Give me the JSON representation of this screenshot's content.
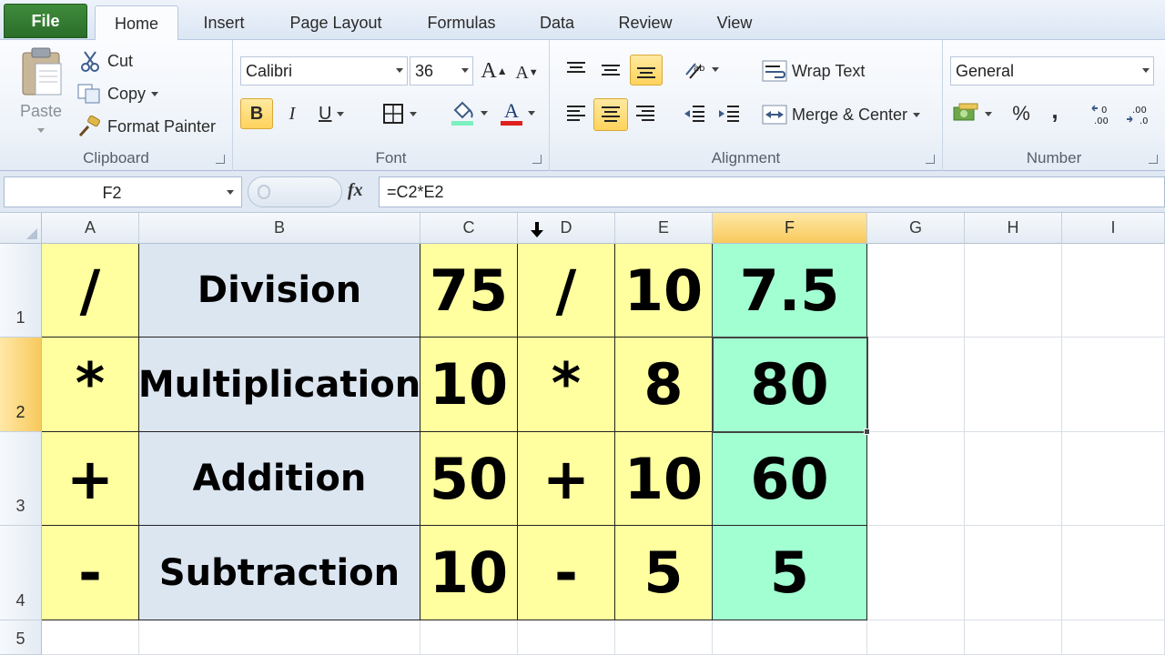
{
  "tabs": {
    "file": "File",
    "home": "Home",
    "insert": "Insert",
    "page_layout": "Page Layout",
    "formulas": "Formulas",
    "data": "Data",
    "review": "Review",
    "view": "View"
  },
  "ribbon": {
    "clipboard": {
      "label": "Clipboard",
      "paste": "Paste",
      "cut": "Cut",
      "copy": "Copy",
      "format_painter": "Format Painter"
    },
    "font": {
      "label": "Font",
      "font_name": "Calibri",
      "font_size": "36",
      "bold": "B",
      "italic": "I",
      "underline": "U"
    },
    "alignment": {
      "label": "Alignment",
      "wrap_text": "Wrap Text",
      "merge_center": "Merge & Center"
    },
    "number": {
      "label": "Number",
      "format": "General",
      "percent": "%",
      "comma": ","
    }
  },
  "formula_bar": {
    "name_box": "F2",
    "fx": "fx",
    "formula": "=C2*E2"
  },
  "sheet": {
    "columns": [
      "A",
      "B",
      "C",
      "D",
      "E",
      "F",
      "G",
      "H",
      "I"
    ],
    "selected_column": "F",
    "selected_row": "2",
    "rows": [
      {
        "num": "1",
        "A": "/",
        "B": "Division",
        "C": "75",
        "D": "/",
        "E": "10",
        "F": "7.5"
      },
      {
        "num": "2",
        "A": "*",
        "B": "Multiplication",
        "C": "10",
        "D": "*",
        "E": "8",
        "F": "80"
      },
      {
        "num": "3",
        "A": "+",
        "B": "Addition",
        "C": "50",
        "D": "+",
        "E": "10",
        "F": "60"
      },
      {
        "num": "4",
        "A": "-",
        "B": "Subtraction",
        "C": "10",
        "D": "-",
        "E": "5",
        "F": "5"
      },
      {
        "num": "5"
      }
    ]
  },
  "colors": {
    "operator_cells": "#ffff9f",
    "label_cells": "#dce6f1",
    "result_cells": "#a2ffd2",
    "selection_header": "#f8c95c"
  }
}
